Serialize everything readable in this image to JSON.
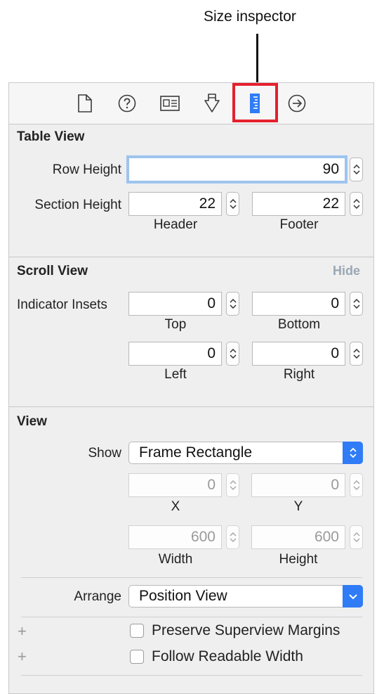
{
  "callout": {
    "label": "Size inspector"
  },
  "toolbar": {
    "icons": [
      "file-inspector-icon",
      "quick-help-icon",
      "identity-inspector-icon",
      "attributes-inspector-icon",
      "size-inspector-icon",
      "connections-inspector-icon"
    ],
    "selected": "size-inspector-icon",
    "accent_color": "#2f7cf6",
    "highlight_color": "#e5202e"
  },
  "table_view": {
    "title": "Table View",
    "row_height_label": "Row Height",
    "row_height_value": "90",
    "section_height_label": "Section Height",
    "header_value": "22",
    "footer_value": "22",
    "header_label": "Header",
    "footer_label": "Footer"
  },
  "scroll_view": {
    "title": "Scroll View",
    "hide_label": "Hide",
    "indicator_insets_label": "Indicator Insets",
    "top_value": "0",
    "bottom_value": "0",
    "left_value": "0",
    "right_value": "0",
    "top_label": "Top",
    "bottom_label": "Bottom",
    "left_label": "Left",
    "right_label": "Right"
  },
  "view": {
    "title": "View",
    "show_label": "Show",
    "show_value": "Frame Rectangle",
    "x_value": "0",
    "y_value": "0",
    "x_label": "X",
    "y_label": "Y",
    "width_value": "600",
    "height_value": "600",
    "width_label": "Width",
    "height_label": "Height",
    "arrange_label": "Arrange",
    "arrange_value": "Position View",
    "preserve_margins_label": "Preserve Superview Margins",
    "preserve_margins_checked": false,
    "readable_width_label": "Follow Readable Width",
    "readable_width_checked": false,
    "plus_symbol": "+"
  }
}
